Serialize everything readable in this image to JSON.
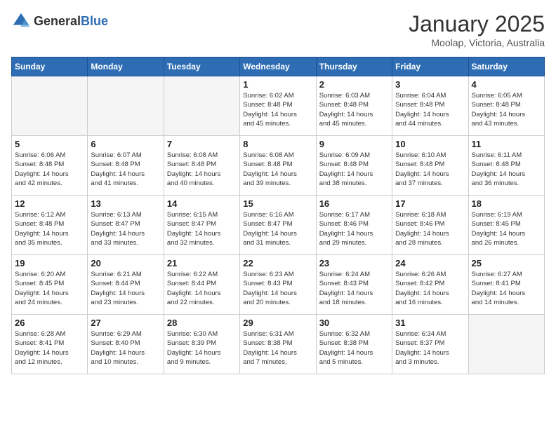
{
  "logo": {
    "general": "General",
    "blue": "Blue"
  },
  "header": {
    "month": "January 2025",
    "location": "Moolap, Victoria, Australia"
  },
  "days_of_week": [
    "Sunday",
    "Monday",
    "Tuesday",
    "Wednesday",
    "Thursday",
    "Friday",
    "Saturday"
  ],
  "weeks": [
    [
      {
        "day": "",
        "info": ""
      },
      {
        "day": "",
        "info": ""
      },
      {
        "day": "",
        "info": ""
      },
      {
        "day": "1",
        "info": "Sunrise: 6:02 AM\nSunset: 8:48 PM\nDaylight: 14 hours\nand 45 minutes."
      },
      {
        "day": "2",
        "info": "Sunrise: 6:03 AM\nSunset: 8:48 PM\nDaylight: 14 hours\nand 45 minutes."
      },
      {
        "day": "3",
        "info": "Sunrise: 6:04 AM\nSunset: 8:48 PM\nDaylight: 14 hours\nand 44 minutes."
      },
      {
        "day": "4",
        "info": "Sunrise: 6:05 AM\nSunset: 8:48 PM\nDaylight: 14 hours\nand 43 minutes."
      }
    ],
    [
      {
        "day": "5",
        "info": "Sunrise: 6:06 AM\nSunset: 8:48 PM\nDaylight: 14 hours\nand 42 minutes."
      },
      {
        "day": "6",
        "info": "Sunrise: 6:07 AM\nSunset: 8:48 PM\nDaylight: 14 hours\nand 41 minutes."
      },
      {
        "day": "7",
        "info": "Sunrise: 6:08 AM\nSunset: 8:48 PM\nDaylight: 14 hours\nand 40 minutes."
      },
      {
        "day": "8",
        "info": "Sunrise: 6:08 AM\nSunset: 8:48 PM\nDaylight: 14 hours\nand 39 minutes."
      },
      {
        "day": "9",
        "info": "Sunrise: 6:09 AM\nSunset: 8:48 PM\nDaylight: 14 hours\nand 38 minutes."
      },
      {
        "day": "10",
        "info": "Sunrise: 6:10 AM\nSunset: 8:48 PM\nDaylight: 14 hours\nand 37 minutes."
      },
      {
        "day": "11",
        "info": "Sunrise: 6:11 AM\nSunset: 8:48 PM\nDaylight: 14 hours\nand 36 minutes."
      }
    ],
    [
      {
        "day": "12",
        "info": "Sunrise: 6:12 AM\nSunset: 8:48 PM\nDaylight: 14 hours\nand 35 minutes."
      },
      {
        "day": "13",
        "info": "Sunrise: 6:13 AM\nSunset: 8:47 PM\nDaylight: 14 hours\nand 33 minutes."
      },
      {
        "day": "14",
        "info": "Sunrise: 6:15 AM\nSunset: 8:47 PM\nDaylight: 14 hours\nand 32 minutes."
      },
      {
        "day": "15",
        "info": "Sunrise: 6:16 AM\nSunset: 8:47 PM\nDaylight: 14 hours\nand 31 minutes."
      },
      {
        "day": "16",
        "info": "Sunrise: 6:17 AM\nSunset: 8:46 PM\nDaylight: 14 hours\nand 29 minutes."
      },
      {
        "day": "17",
        "info": "Sunrise: 6:18 AM\nSunset: 8:46 PM\nDaylight: 14 hours\nand 28 minutes."
      },
      {
        "day": "18",
        "info": "Sunrise: 6:19 AM\nSunset: 8:45 PM\nDaylight: 14 hours\nand 26 minutes."
      }
    ],
    [
      {
        "day": "19",
        "info": "Sunrise: 6:20 AM\nSunset: 8:45 PM\nDaylight: 14 hours\nand 24 minutes."
      },
      {
        "day": "20",
        "info": "Sunrise: 6:21 AM\nSunset: 8:44 PM\nDaylight: 14 hours\nand 23 minutes."
      },
      {
        "day": "21",
        "info": "Sunrise: 6:22 AM\nSunset: 8:44 PM\nDaylight: 14 hours\nand 22 minutes."
      },
      {
        "day": "22",
        "info": "Sunrise: 6:23 AM\nSunset: 8:43 PM\nDaylight: 14 hours\nand 20 minutes."
      },
      {
        "day": "23",
        "info": "Sunrise: 6:24 AM\nSunset: 8:43 PM\nDaylight: 14 hours\nand 18 minutes."
      },
      {
        "day": "24",
        "info": "Sunrise: 6:26 AM\nSunset: 8:42 PM\nDaylight: 14 hours\nand 16 minutes."
      },
      {
        "day": "25",
        "info": "Sunrise: 6:27 AM\nSunset: 8:41 PM\nDaylight: 14 hours\nand 14 minutes."
      }
    ],
    [
      {
        "day": "26",
        "info": "Sunrise: 6:28 AM\nSunset: 8:41 PM\nDaylight: 14 hours\nand 12 minutes."
      },
      {
        "day": "27",
        "info": "Sunrise: 6:29 AM\nSunset: 8:40 PM\nDaylight: 14 hours\nand 10 minutes."
      },
      {
        "day": "28",
        "info": "Sunrise: 6:30 AM\nSunset: 8:39 PM\nDaylight: 14 hours\nand 9 minutes."
      },
      {
        "day": "29",
        "info": "Sunrise: 6:31 AM\nSunset: 8:38 PM\nDaylight: 14 hours\nand 7 minutes."
      },
      {
        "day": "30",
        "info": "Sunrise: 6:32 AM\nSunset: 8:38 PM\nDaylight: 14 hours\nand 5 minutes."
      },
      {
        "day": "31",
        "info": "Sunrise: 6:34 AM\nSunset: 8:37 PM\nDaylight: 14 hours\nand 3 minutes."
      },
      {
        "day": "",
        "info": ""
      }
    ]
  ]
}
